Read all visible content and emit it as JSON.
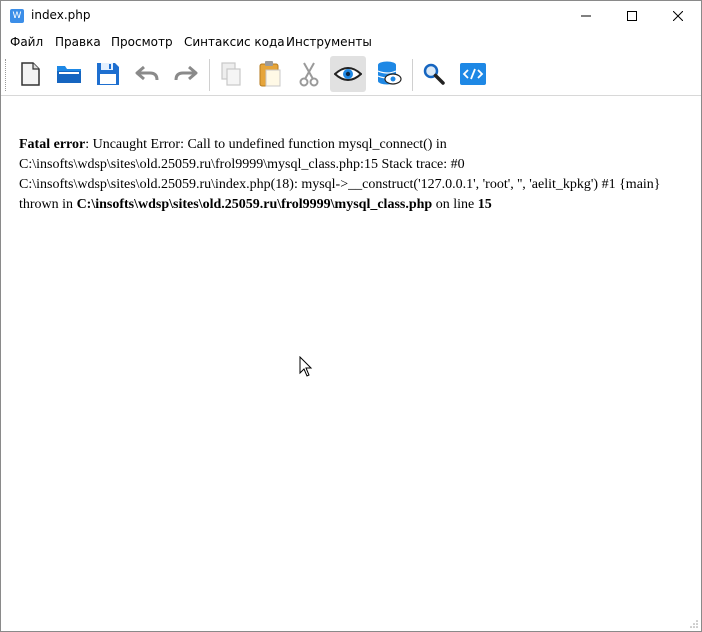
{
  "window": {
    "title": "index.php",
    "app_icon_letter": "W"
  },
  "menu": {
    "items": [
      "Файл",
      "Правка",
      "Просмотр",
      "Синтаксис кода",
      "Инструменты"
    ]
  },
  "toolbar": {
    "buttons": [
      "new-file-icon",
      "open-folder-icon",
      "save-icon",
      "undo-icon",
      "redo-icon",
      "copy-icon",
      "paste-icon",
      "cut-icon",
      "preview-eye-icon",
      "database-view-icon",
      "search-icon",
      "code-view-icon"
    ],
    "active": "preview-eye-icon"
  },
  "error": {
    "label": "Fatal error",
    "message": ": Uncaught Error: Call to undefined function mysql_connect() in C:\\insofts\\wdsp\\sites\\old.25059.ru\\frol9999\\mysql_class.php:15 Stack trace: #0 C:\\insofts\\wdsp\\sites\\old.25059.ru\\index.php(18): mysql->__construct('127.0.0.1', 'root', '', 'aelit_kpkg') #1 {main} thrown in ",
    "file": "C:\\insofts\\wdsp\\sites\\old.25059.ru\\frol9999\\mysql_class.php",
    "on_line_text": " on line ",
    "line": "15"
  },
  "colors": {
    "accent_blue": "#1e88e5",
    "toolbar_active_bg": "#e1e1e1"
  }
}
